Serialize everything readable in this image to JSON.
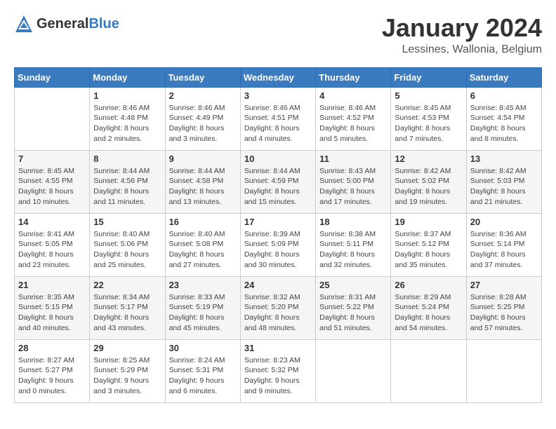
{
  "header": {
    "logo_general": "General",
    "logo_blue": "Blue",
    "month_year": "January 2024",
    "location": "Lessines, Wallonia, Belgium"
  },
  "days_of_week": [
    "Sunday",
    "Monday",
    "Tuesday",
    "Wednesday",
    "Thursday",
    "Friday",
    "Saturday"
  ],
  "weeks": [
    [
      {
        "day": "",
        "sunrise": "",
        "sunset": "",
        "daylight": ""
      },
      {
        "day": "1",
        "sunrise": "Sunrise: 8:46 AM",
        "sunset": "Sunset: 4:48 PM",
        "daylight": "Daylight: 8 hours and 2 minutes."
      },
      {
        "day": "2",
        "sunrise": "Sunrise: 8:46 AM",
        "sunset": "Sunset: 4:49 PM",
        "daylight": "Daylight: 8 hours and 3 minutes."
      },
      {
        "day": "3",
        "sunrise": "Sunrise: 8:46 AM",
        "sunset": "Sunset: 4:51 PM",
        "daylight": "Daylight: 8 hours and 4 minutes."
      },
      {
        "day": "4",
        "sunrise": "Sunrise: 8:46 AM",
        "sunset": "Sunset: 4:52 PM",
        "daylight": "Daylight: 8 hours and 5 minutes."
      },
      {
        "day": "5",
        "sunrise": "Sunrise: 8:45 AM",
        "sunset": "Sunset: 4:53 PM",
        "daylight": "Daylight: 8 hours and 7 minutes."
      },
      {
        "day": "6",
        "sunrise": "Sunrise: 8:45 AM",
        "sunset": "Sunset: 4:54 PM",
        "daylight": "Daylight: 8 hours and 8 minutes."
      }
    ],
    [
      {
        "day": "7",
        "sunrise": "Sunrise: 8:45 AM",
        "sunset": "Sunset: 4:55 PM",
        "daylight": "Daylight: 8 hours and 10 minutes."
      },
      {
        "day": "8",
        "sunrise": "Sunrise: 8:44 AM",
        "sunset": "Sunset: 4:56 PM",
        "daylight": "Daylight: 8 hours and 11 minutes."
      },
      {
        "day": "9",
        "sunrise": "Sunrise: 8:44 AM",
        "sunset": "Sunset: 4:58 PM",
        "daylight": "Daylight: 8 hours and 13 minutes."
      },
      {
        "day": "10",
        "sunrise": "Sunrise: 8:44 AM",
        "sunset": "Sunset: 4:59 PM",
        "daylight": "Daylight: 8 hours and 15 minutes."
      },
      {
        "day": "11",
        "sunrise": "Sunrise: 8:43 AM",
        "sunset": "Sunset: 5:00 PM",
        "daylight": "Daylight: 8 hours and 17 minutes."
      },
      {
        "day": "12",
        "sunrise": "Sunrise: 8:42 AM",
        "sunset": "Sunset: 5:02 PM",
        "daylight": "Daylight: 8 hours and 19 minutes."
      },
      {
        "day": "13",
        "sunrise": "Sunrise: 8:42 AM",
        "sunset": "Sunset: 5:03 PM",
        "daylight": "Daylight: 8 hours and 21 minutes."
      }
    ],
    [
      {
        "day": "14",
        "sunrise": "Sunrise: 8:41 AM",
        "sunset": "Sunset: 5:05 PM",
        "daylight": "Daylight: 8 hours and 23 minutes."
      },
      {
        "day": "15",
        "sunrise": "Sunrise: 8:40 AM",
        "sunset": "Sunset: 5:06 PM",
        "daylight": "Daylight: 8 hours and 25 minutes."
      },
      {
        "day": "16",
        "sunrise": "Sunrise: 8:40 AM",
        "sunset": "Sunset: 5:08 PM",
        "daylight": "Daylight: 8 hours and 27 minutes."
      },
      {
        "day": "17",
        "sunrise": "Sunrise: 8:39 AM",
        "sunset": "Sunset: 5:09 PM",
        "daylight": "Daylight: 8 hours and 30 minutes."
      },
      {
        "day": "18",
        "sunrise": "Sunrise: 8:38 AM",
        "sunset": "Sunset: 5:11 PM",
        "daylight": "Daylight: 8 hours and 32 minutes."
      },
      {
        "day": "19",
        "sunrise": "Sunrise: 8:37 AM",
        "sunset": "Sunset: 5:12 PM",
        "daylight": "Daylight: 8 hours and 35 minutes."
      },
      {
        "day": "20",
        "sunrise": "Sunrise: 8:36 AM",
        "sunset": "Sunset: 5:14 PM",
        "daylight": "Daylight: 8 hours and 37 minutes."
      }
    ],
    [
      {
        "day": "21",
        "sunrise": "Sunrise: 8:35 AM",
        "sunset": "Sunset: 5:15 PM",
        "daylight": "Daylight: 8 hours and 40 minutes."
      },
      {
        "day": "22",
        "sunrise": "Sunrise: 8:34 AM",
        "sunset": "Sunset: 5:17 PM",
        "daylight": "Daylight: 8 hours and 43 minutes."
      },
      {
        "day": "23",
        "sunrise": "Sunrise: 8:33 AM",
        "sunset": "Sunset: 5:19 PM",
        "daylight": "Daylight: 8 hours and 45 minutes."
      },
      {
        "day": "24",
        "sunrise": "Sunrise: 8:32 AM",
        "sunset": "Sunset: 5:20 PM",
        "daylight": "Daylight: 8 hours and 48 minutes."
      },
      {
        "day": "25",
        "sunrise": "Sunrise: 8:31 AM",
        "sunset": "Sunset: 5:22 PM",
        "daylight": "Daylight: 8 hours and 51 minutes."
      },
      {
        "day": "26",
        "sunrise": "Sunrise: 8:29 AM",
        "sunset": "Sunset: 5:24 PM",
        "daylight": "Daylight: 8 hours and 54 minutes."
      },
      {
        "day": "27",
        "sunrise": "Sunrise: 8:28 AM",
        "sunset": "Sunset: 5:25 PM",
        "daylight": "Daylight: 8 hours and 57 minutes."
      }
    ],
    [
      {
        "day": "28",
        "sunrise": "Sunrise: 8:27 AM",
        "sunset": "Sunset: 5:27 PM",
        "daylight": "Daylight: 9 hours and 0 minutes."
      },
      {
        "day": "29",
        "sunrise": "Sunrise: 8:25 AM",
        "sunset": "Sunset: 5:29 PM",
        "daylight": "Daylight: 9 hours and 3 minutes."
      },
      {
        "day": "30",
        "sunrise": "Sunrise: 8:24 AM",
        "sunset": "Sunset: 5:31 PM",
        "daylight": "Daylight: 9 hours and 6 minutes."
      },
      {
        "day": "31",
        "sunrise": "Sunrise: 8:23 AM",
        "sunset": "Sunset: 5:32 PM",
        "daylight": "Daylight: 9 hours and 9 minutes."
      },
      {
        "day": "",
        "sunrise": "",
        "sunset": "",
        "daylight": ""
      },
      {
        "day": "",
        "sunrise": "",
        "sunset": "",
        "daylight": ""
      },
      {
        "day": "",
        "sunrise": "",
        "sunset": "",
        "daylight": ""
      }
    ]
  ]
}
